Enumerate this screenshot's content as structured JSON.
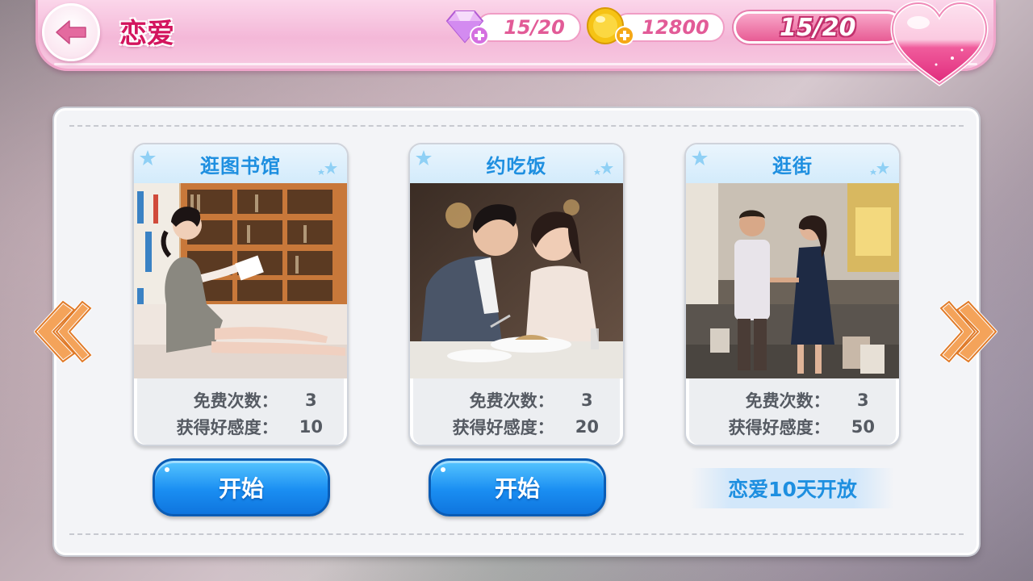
{
  "header": {
    "title": "恋爱",
    "gems": "15/20",
    "gold": "12800",
    "stamina": "15/20"
  },
  "cards": [
    {
      "title": "逛图书馆",
      "scene": "library",
      "free_label": "免费次数：",
      "free_value": "3",
      "favor_label": "获得好感度：",
      "favor_value": "10",
      "action": "开始"
    },
    {
      "title": "约吃饭",
      "scene": "dinner",
      "free_label": "免费次数：",
      "free_value": "3",
      "favor_label": "获得好感度：",
      "favor_value": "20",
      "action": "开始"
    },
    {
      "title": "逛街",
      "scene": "shopping",
      "free_label": "免费次数：",
      "free_value": "3",
      "favor_label": "获得好感度：",
      "favor_value": "50",
      "locked_note": "恋爱10天开放"
    }
  ],
  "colors": {
    "accent_pink": "#d3155e",
    "accent_blue": "#1e8fe0",
    "button_blue": "#1a8ef2"
  }
}
